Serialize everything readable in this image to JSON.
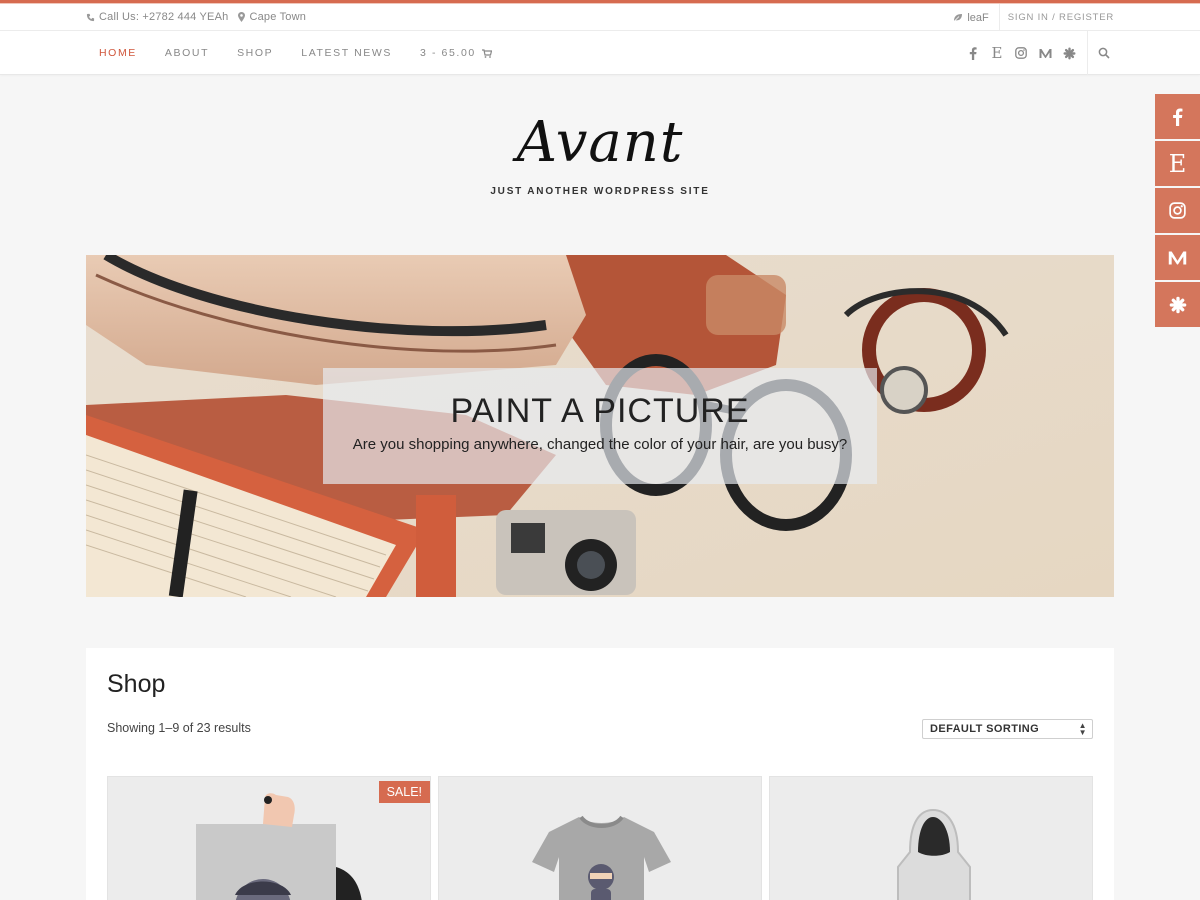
{
  "colors": {
    "accent": "#d66b50",
    "nav_active": "#d0563b",
    "social_button": "#d4765c"
  },
  "topbar": {
    "phone_icon": "phone-icon",
    "phone": "Call Us: +2782 444 YEAh",
    "location_icon": "map-marker-icon",
    "location": "Cape Town",
    "leaf_icon": "leaf-icon",
    "leaf_text": "leaF",
    "signin": "SIGN IN / REGISTER"
  },
  "nav": {
    "items": [
      "HOME",
      "ABOUT",
      "SHOP",
      "LATEST NEWS"
    ],
    "active": "HOME",
    "cart": "3 - 65.00",
    "cart_icon": "cart-icon",
    "social_icons": [
      "facebook-icon",
      "etsy-icon",
      "instagram-icon",
      "medium-icon",
      "slack-icon"
    ],
    "search_icon": "search-icon"
  },
  "site": {
    "title": "Avant",
    "tagline": "JUST ANOTHER WORDPRESS SITE"
  },
  "hero": {
    "title": "PAINT A PICTURE",
    "subtitle": "Are you shopping anywhere, changed the color of your hair, are you busy?"
  },
  "side_social": [
    "facebook-icon",
    "etsy-icon",
    "instagram-icon",
    "medium-icon",
    "slack-icon"
  ],
  "shop": {
    "title": "Shop",
    "result_count": "Showing 1–9 of 23 results",
    "sort_selected": "DEFAULT SORTING",
    "sale_badge": "SALE!"
  }
}
